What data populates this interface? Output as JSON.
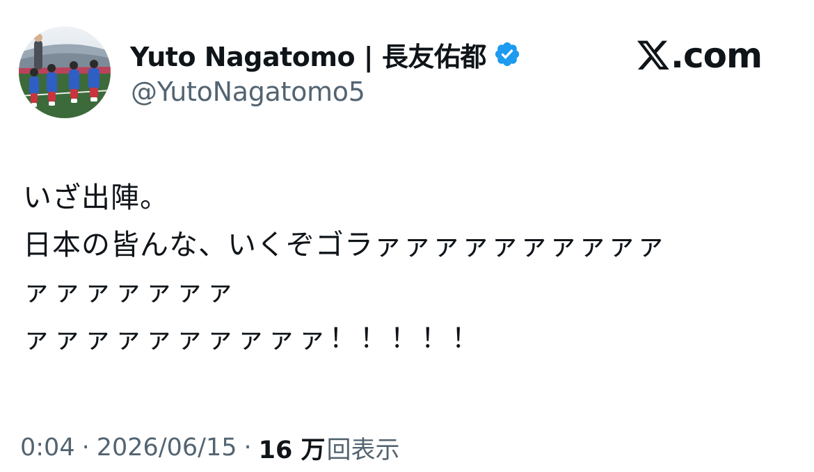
{
  "author": {
    "display_name": "Yuto Nagatomo | 長友佑都",
    "handle": "@YutoNagatomo5",
    "verified": true,
    "avatar_icon": "avatar-photo-children-stadium"
  },
  "brand": {
    "icon": "x-logo-icon",
    "text": ".com"
  },
  "tweet": {
    "lines": [
      "いざ出陣。",
      "日本の皆んな、いくぞゴラァァァァァァァァァァ",
      "ァァァァァァァ",
      "ァァァァァァァァァァ！！！！！"
    ]
  },
  "meta": {
    "time": "0:04",
    "separator": "·",
    "date": "2026/06/15",
    "views_count": "16 万",
    "views_label": "回表示"
  },
  "colors": {
    "text_primary": "#0f1419",
    "text_secondary": "#536471",
    "verified_blue": "#1d9bf0",
    "background": "#ffffff"
  }
}
